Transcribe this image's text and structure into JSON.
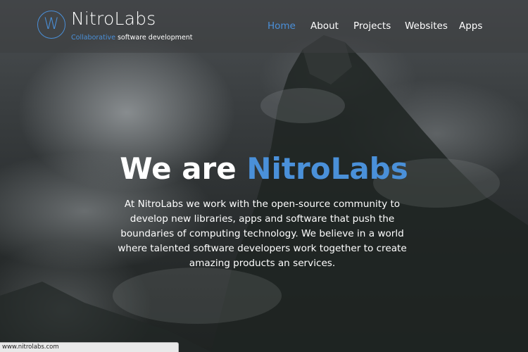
{
  "brand": {
    "logo_letter": "W",
    "name": "NitroLabs",
    "tagline_accent": "Collaborative",
    "tagline_rest": "software development"
  },
  "nav": {
    "items": [
      {
        "label": "Home",
        "active": true
      },
      {
        "label": "About",
        "active": false
      },
      {
        "label": "Projects",
        "active": false
      },
      {
        "label": "Websites",
        "active": false
      },
      {
        "label": "Apps",
        "active": false
      }
    ]
  },
  "hero": {
    "headline_prefix": "We are",
    "headline_highlight": "NitroLabs",
    "intro": "At NitroLabs we work with the open-source community to develop new libraries, apps and software that push the boundaries of computing technology. We believe in a world where talented software developers work together to create amazing products an services."
  },
  "status_bar": {
    "url": "www.nitrolabs.com"
  },
  "colors": {
    "accent": "#4a90d9",
    "text": "#ffffff",
    "nav_bar": "#3c3e40"
  }
}
